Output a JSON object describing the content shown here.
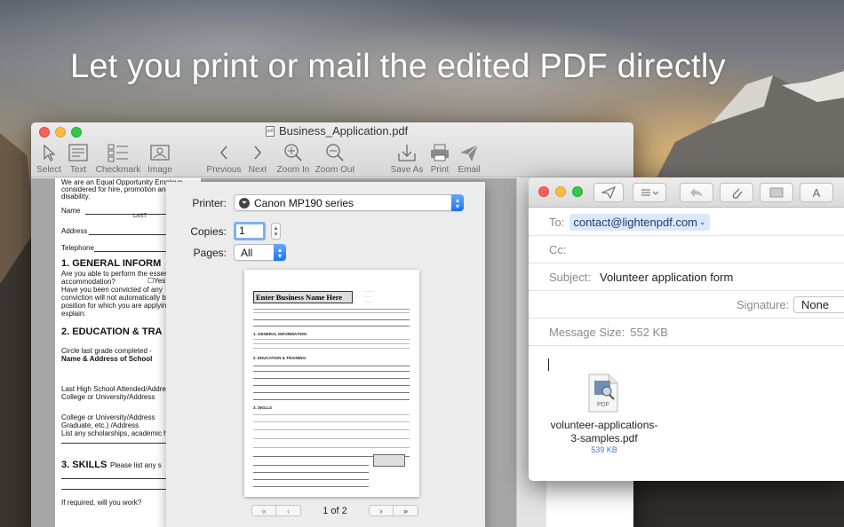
{
  "headline": "Let you print or mail the edited PDF directly",
  "app": {
    "title": "Business_Application.pdf",
    "toolbar": {
      "select": "Select",
      "text": "Text",
      "checkmark": "Checkmark",
      "image": "Image",
      "previous": "Previous",
      "next": "Next",
      "zoom_in": "Zoom In",
      "zoom_out": "Zoom Out",
      "save_as": "Save As",
      "print": "Print",
      "email": "Email"
    },
    "document": {
      "lines": [
        "We are an Equal Opportunity Employe",
        "considered for hire, promotion and job s",
        "disability.",
        "Name",
        "LAST",
        "Address",
        "Telephone",
        "1.  GENERAL INFORM",
        "Are you able to perform the essent",
        "accommodation?",
        "Yes",
        "N",
        "Have you been convicted of any",
        "conviction will not automatically ba",
        "position for which you are applying.",
        "explain:",
        "2.  EDUCATION & TRA",
        "Circle last grade completed -",
        "Name & Address of School",
        "Last High School Attended/Address",
        "College or University/Address",
        "College or University/Address",
        "Graduate, etc.) /Address",
        "List any scholarships, academic ho",
        "3.  SKILLS",
        "Please list any s",
        "If required, will you work?"
      ]
    }
  },
  "print_dialog": {
    "printer_label": "Printer:",
    "printer_value": "Canon MP190 series",
    "copies_label": "Copies:",
    "copies_value": "1",
    "pages_label": "Pages:",
    "pages_value": "All",
    "preview_title": "Enter Business Name Here",
    "preview_sections": [
      "1. GENERAL INFORMATION:",
      "2. EDUCATION & TRAINING:",
      "3. SKILLS"
    ],
    "page_indicator": "1 of 2"
  },
  "mail": {
    "to_label": "To:",
    "to_value": "contact@lightenpdf.com",
    "cc_label": "Cc:",
    "subject_label": "Subject:",
    "subject_value": "Volunteer application form",
    "signature_label": "Signature:",
    "signature_value": "None",
    "message_size_label": "Message Size:",
    "message_size_value": "552 KB",
    "attachment_badge": "PDF",
    "attachment_name_line1": "volunteer-applications-",
    "attachment_name_line2": "3-samples.pdf",
    "attachment_size": "539 KB",
    "format_button": "A"
  },
  "colors": {
    "accent": "#1e74e8",
    "token_bg": "#dbe8f8",
    "close": "#fc605c",
    "minimize": "#fdbc40",
    "zoom": "#34c84a"
  }
}
